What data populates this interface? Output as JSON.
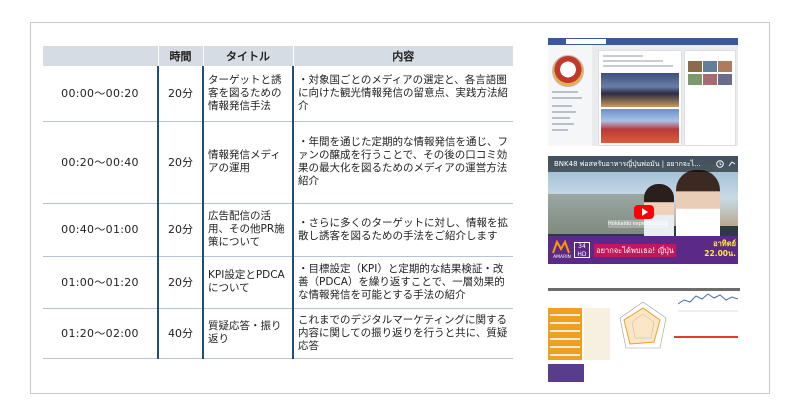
{
  "table": {
    "headers": [
      "",
      "時間",
      "タイトル",
      "内容"
    ],
    "rows": [
      {
        "range": "00:00〜00:20",
        "minutes": "20分",
        "title": "ターゲットと誘客を図るための情報発信手法",
        "content": "・対象国ごとのメディアの選定と、各言語圏に向けた観光情報発信の留意点、実践方法紹介"
      },
      {
        "range": "00:20〜00:40",
        "minutes": "20分",
        "title": "情報発信メディアの運用",
        "content": "・年間を通じた定期的な情報発信を通じ、ファンの醸成を行うことで、その後の口コミ効果の最大化を図るためのメディアの運営方法紹介"
      },
      {
        "range": "00:40〜01:00",
        "minutes": "20分",
        "title": "広告配信の活用、その他PR施策について",
        "content": "・さらに多くのターゲットに対し、情報を拡散し誘客を図るための手法をご紹介します"
      },
      {
        "range": "01:00〜01:20",
        "minutes": "20分",
        "title": "KPI設定とPDCAについて",
        "content": "・目標設定（KPI）と定期的な結果検証・改善（PDCA）を繰り返すことで、一層効果的な情報発信を可能とする手法の紹介"
      },
      {
        "range": "01:20〜02:00",
        "minutes": "40分",
        "title": "質疑応答・振り返り",
        "content": "これまでのデジタルマーケティングに関する内容に関しての振り返りを行うと共に、質疑応答"
      }
    ]
  },
  "video": {
    "title": "BNK48 พ่อสหรับอาหารญี่ปุ่นพ่อมัน | อยากจะไ...",
    "caption": "Hokkaido experience Lipo",
    "channel_logo": "AMARIN",
    "channel_num": "34 HD",
    "tag": "อยากจะได้พบเธอ! ญี่ปุ่น",
    "time_day": "อาทิตย์",
    "time": "22.00น."
  },
  "icons": {
    "clock": "clock-icon",
    "share": "share-icon",
    "play": "play-icon"
  },
  "colors": {
    "header_bg": "#d6dce4",
    "divider": "#1f4e79",
    "fb_blue": "#3b5998",
    "video_purple": "#5a2a86",
    "tag_pink": "#c2185b",
    "report_orange": "#f0a020"
  }
}
